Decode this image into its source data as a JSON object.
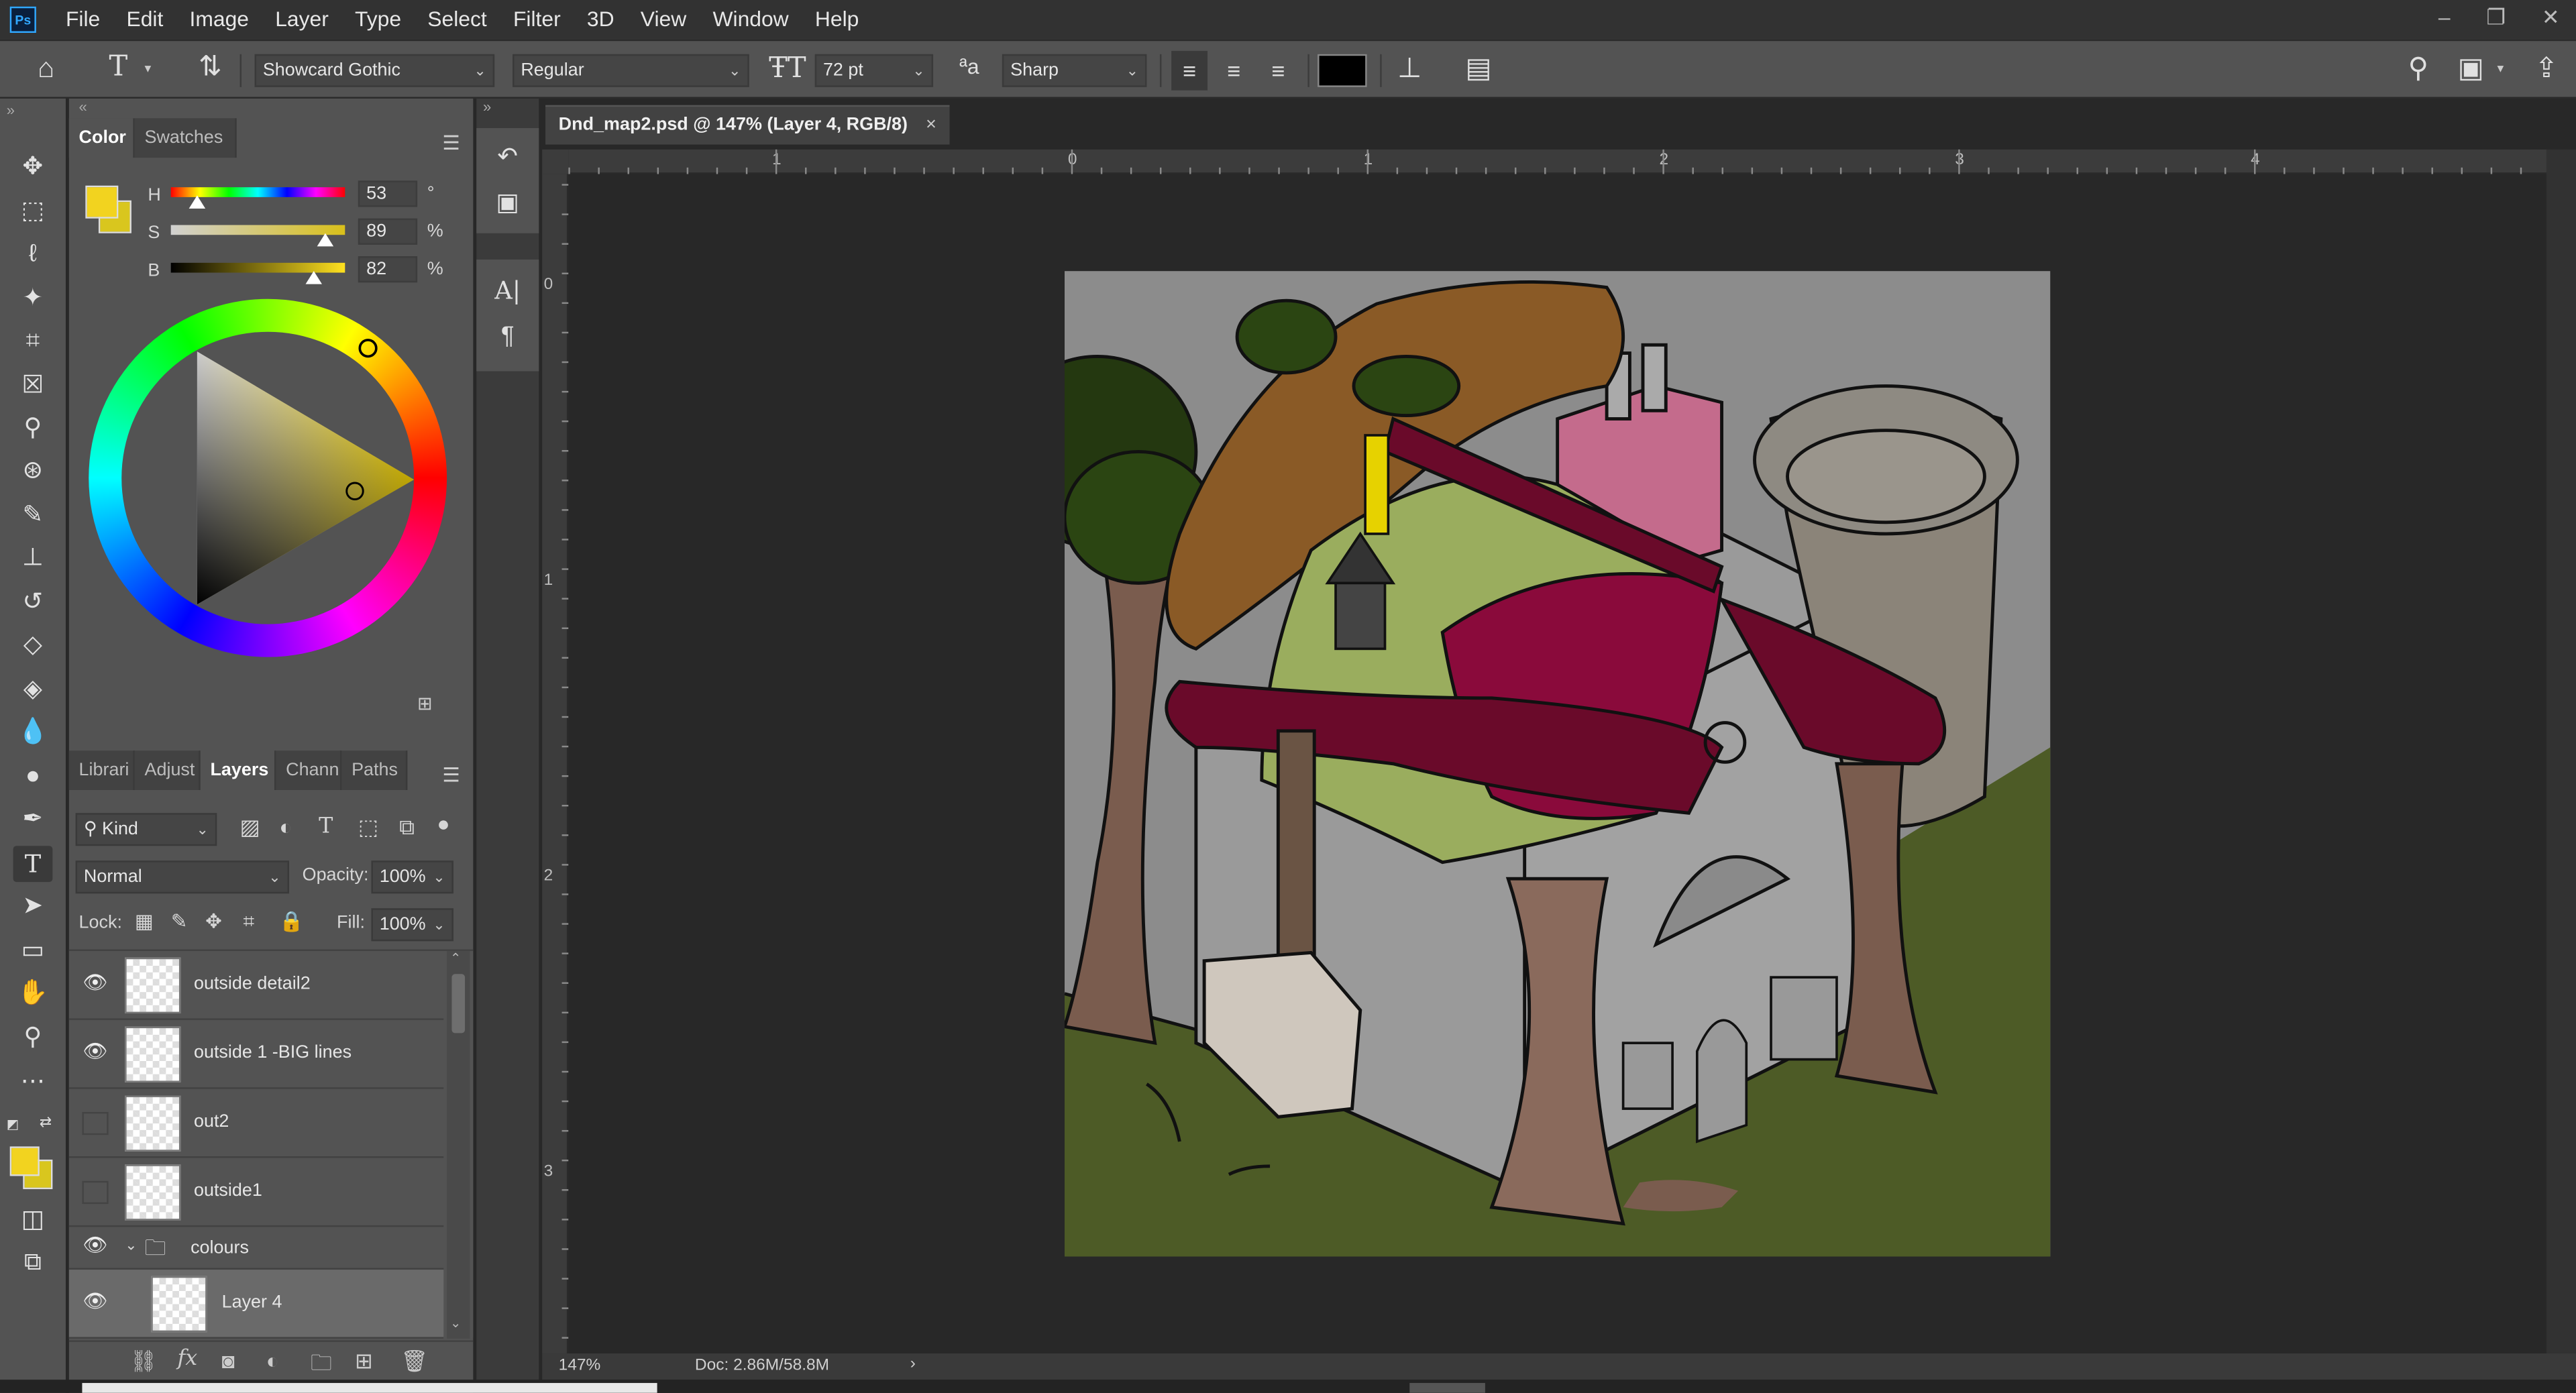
{
  "app": {
    "logo": "Ps"
  },
  "menu": [
    "File",
    "Edit",
    "Image",
    "Layer",
    "Type",
    "Select",
    "Filter",
    "3D",
    "View",
    "Window",
    "Help"
  ],
  "window_controls": [
    "–",
    "❐",
    "✕"
  ],
  "options_bar": {
    "font_family": "Showcard Gothic",
    "font_style": "Regular",
    "font_size": "72 pt",
    "antialias": "Sharp",
    "text_color": "#000000"
  },
  "color_panel": {
    "tabs": [
      "Color",
      "Swatches"
    ],
    "foreground": "#f2d31f",
    "background": "#d9c61e",
    "sliders": [
      {
        "label": "H",
        "value": "53",
        "unit": "°",
        "fraction": 0.147
      },
      {
        "label": "S",
        "value": "89",
        "unit": "%",
        "fraction": 0.89
      },
      {
        "label": "B",
        "value": "82",
        "unit": "%",
        "fraction": 0.82
      }
    ]
  },
  "layers_panel": {
    "tabs": [
      "Librari",
      "Adjust",
      "Layers",
      "Chann",
      "Paths"
    ],
    "filter_kind": "Kind",
    "blend_mode": "Normal",
    "opacity_label": "Opacity:",
    "opacity": "100%",
    "lock_label": "Lock:",
    "fill_label": "Fill:",
    "fill": "100%",
    "layers": [
      {
        "name": "outside detail2",
        "visible": true
      },
      {
        "name": "outside 1 -BIG lines",
        "visible": true
      },
      {
        "name": "out2",
        "visible": false
      },
      {
        "name": "outside1",
        "visible": false
      }
    ],
    "group": {
      "name": "colours",
      "visible": true
    },
    "active_layer": {
      "name": "Layer 4",
      "visible": true
    }
  },
  "document": {
    "tab_title": "Dnd_map2.psd @ 147% (Layer 4, RGB/8)",
    "zoom": "147%",
    "doc_size": "Doc: 2.86M/58.8M",
    "ruler_h_labels": [
      "1",
      "0",
      "1",
      "2",
      "3",
      "4"
    ],
    "ruler_v_labels": [
      "0",
      "1",
      "2",
      "3"
    ]
  }
}
